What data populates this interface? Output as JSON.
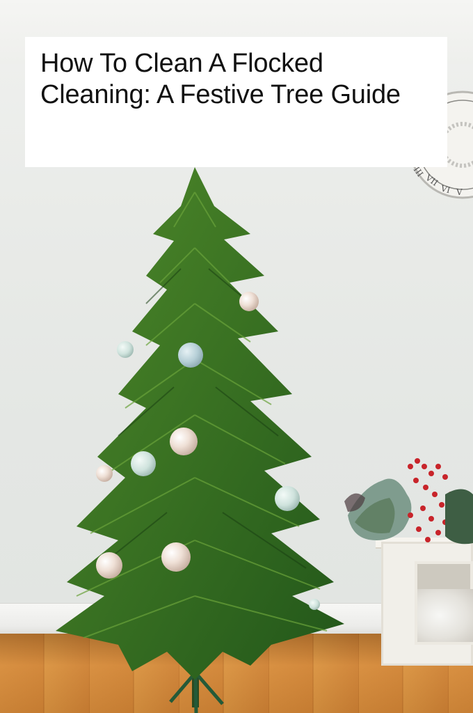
{
  "title_card": {
    "text": "How To Clean A Flocked Cleaning: A Festive Tree Guide"
  },
  "colors": {
    "wall": "#e7e9e6",
    "floor": "#d08536",
    "tree_green": "#2f6b21",
    "ornament_pearl": "#efe2da",
    "ornament_blue": "#b8d3dc",
    "berries_red": "#c8242a"
  },
  "icons": {
    "clock": "wall-clock-icon"
  }
}
